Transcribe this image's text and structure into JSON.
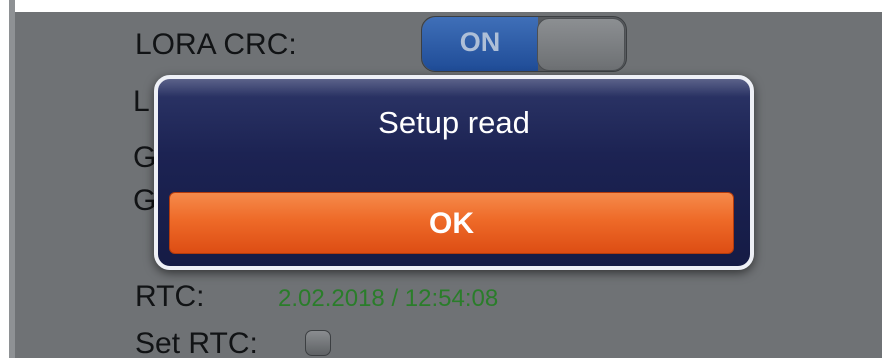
{
  "settings": {
    "lora_crc_label": "LORA CRC:",
    "lora_crc_toggle": "ON",
    "row2_label_partial": "L",
    "row3_label_partial": "G",
    "row4_label_partial": "G",
    "rtc_label": "RTC:",
    "rtc_value": "2.02.2018 / 12:54:08",
    "set_rtc_label": "Set RTC:"
  },
  "dialog": {
    "message": "Setup read",
    "ok_label": "OK"
  },
  "colors": {
    "panel_bg": "#6f7275",
    "dialog_bg": "#1c2353",
    "ok_button": "#ee6a28",
    "rtc_value_text": "#2a7d2a",
    "toggle_on": "#2a5aa5"
  }
}
